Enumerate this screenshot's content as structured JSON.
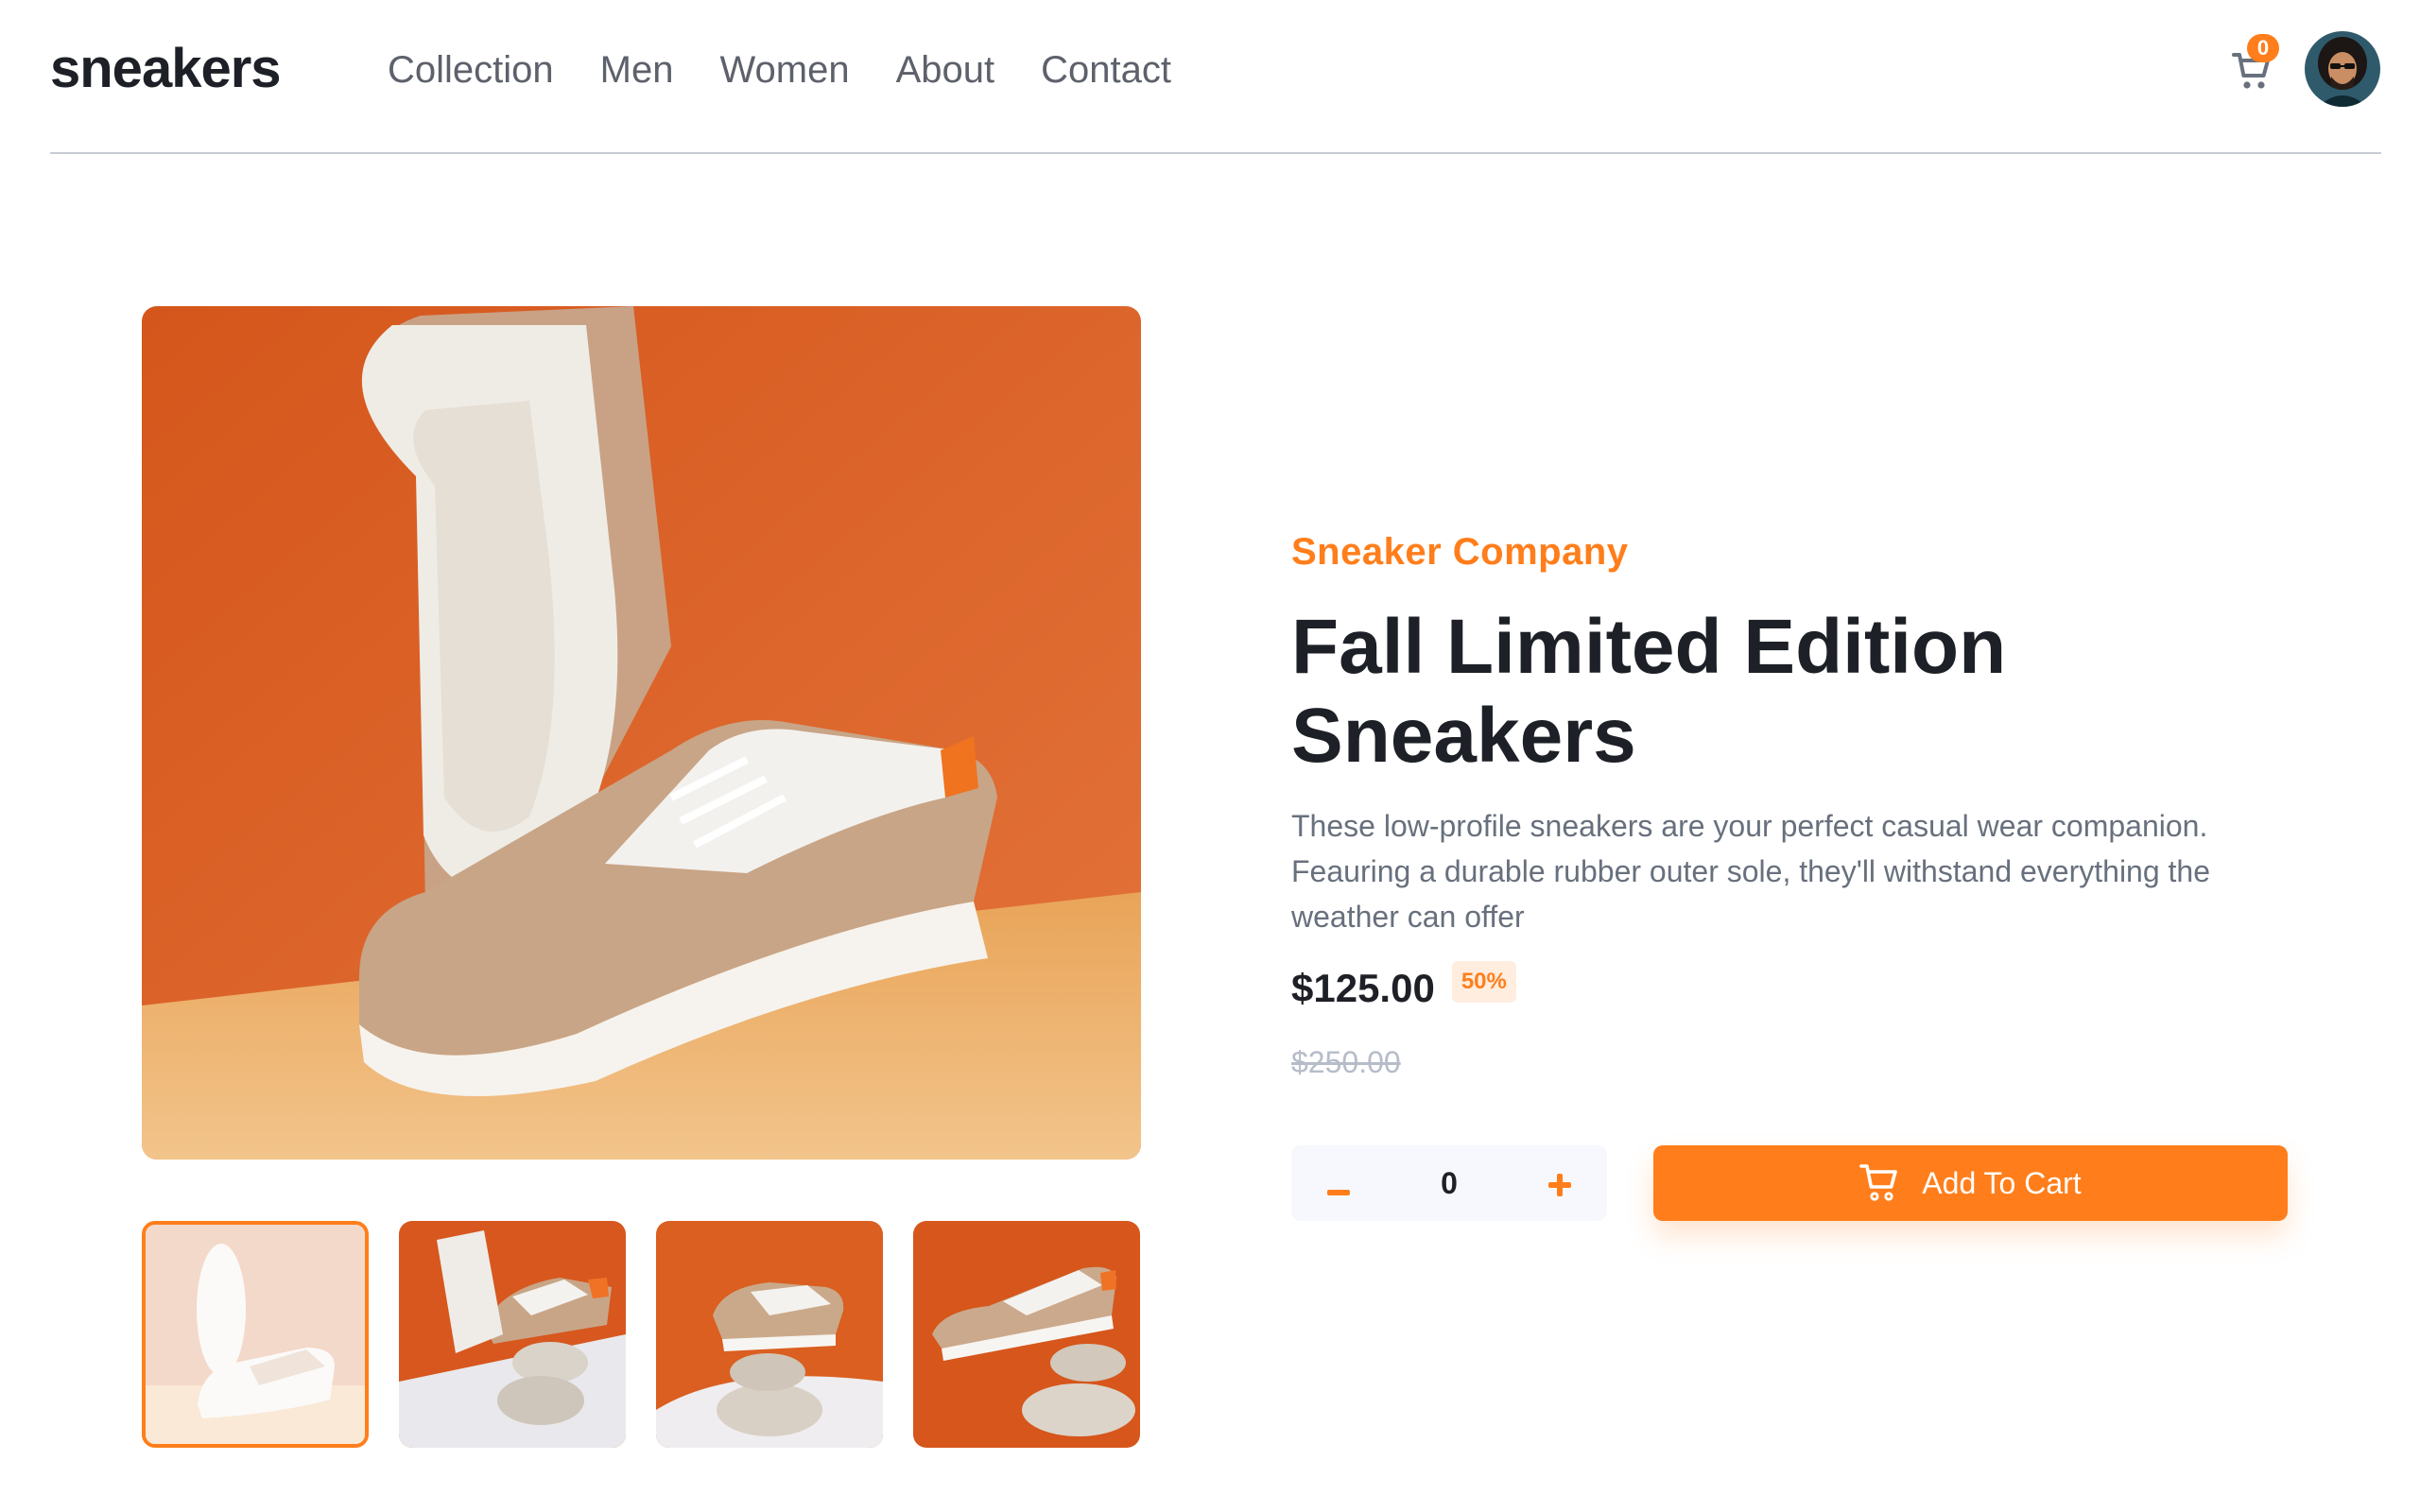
{
  "brand": "sneakers",
  "nav": [
    "Collection",
    "Men",
    "Women",
    "About",
    "Contact"
  ],
  "cart": {
    "count": "0",
    "icon": "cart-icon"
  },
  "avatar": {
    "icon": "user-avatar"
  },
  "product": {
    "company": "Sneaker Company",
    "title": "Fall Limited Edition Sneakers",
    "description": "These low-profile sneakers are your perfect casual wear companion. Feauring a durable rubber outer sole, they'll withstand everything the weather can offer",
    "price": "$125.00",
    "discount": "50%",
    "original_price": "$250.00"
  },
  "quantity": {
    "value": "0",
    "minus_icon": "minus-icon",
    "plus_icon": "plus-icon"
  },
  "add_to_cart": {
    "label": "Add To Cart",
    "icon": "cart-icon"
  },
  "gallery": {
    "thumbnails": 4,
    "active_thumbnail": 1
  },
  "colors": {
    "accent": "#ff7e1b",
    "accent_pale": "#ffede0",
    "text_dark": "#1d2026",
    "text_muted": "#68707d"
  }
}
